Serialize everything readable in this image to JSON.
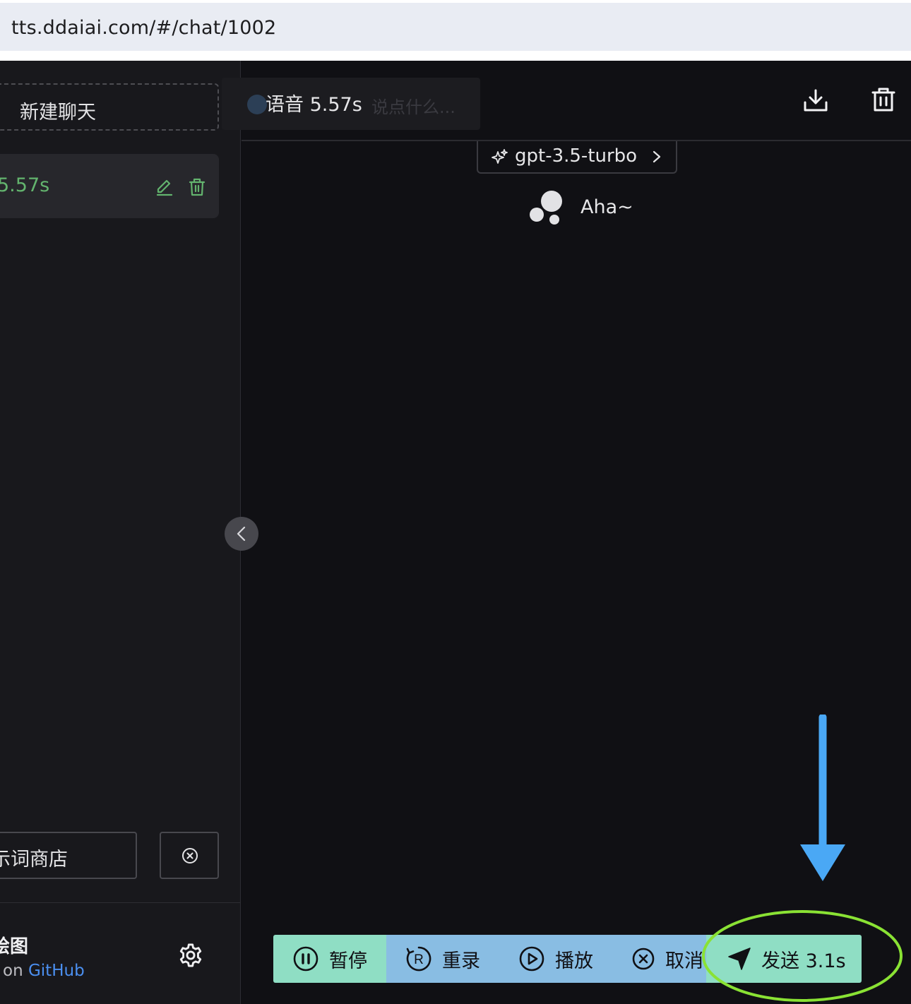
{
  "browser": {
    "url": "tts.ddaiai.com/#/chat/1002"
  },
  "sidebar": {
    "new_chat_label": "新建聊天",
    "history": [
      {
        "title": "5.57s"
      }
    ],
    "prompt_store_label": "示词商店",
    "footer_title": "绘图",
    "footer_prefix": "on",
    "footer_link": "GitHub"
  },
  "header": {
    "voice_tab_label": "语音 5.57s",
    "input_placeholder": "说点什么..."
  },
  "chat": {
    "model_name": "gpt-3.5-turbo",
    "greeting": "Aha~"
  },
  "toolbar": {
    "pause_label": "暂停",
    "rerecord_label": "重录",
    "play_label": "播放",
    "cancel_label": "取消",
    "send_label": "发送 3.1s"
  },
  "colors": {
    "app_background": "#101014",
    "sidebar_background": "#18181c",
    "accent_green": "#63b46e",
    "toolbar_green": "#8fdec4",
    "toolbar_blue": "#89bde3",
    "annotation_arrow": "#4aa8f5",
    "annotation_ellipse": "#8ae234",
    "link_blue": "#4b8ff0"
  }
}
